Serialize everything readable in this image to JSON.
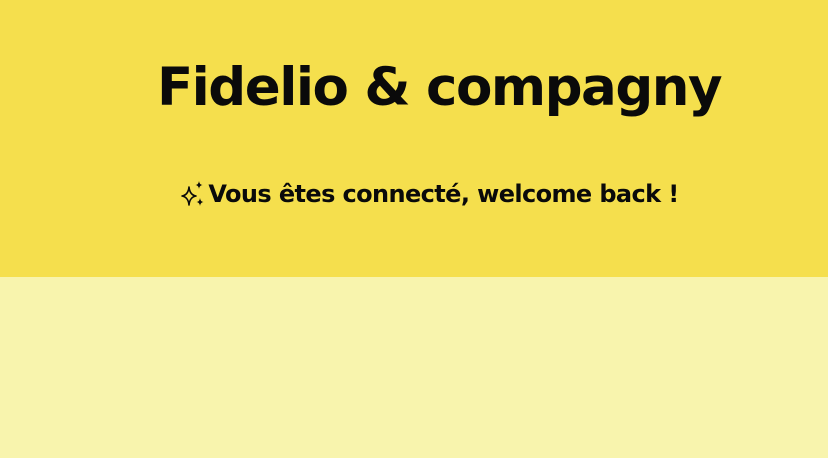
{
  "header": {
    "title": "Fidelio & compagny",
    "welcome_message": "Vous êtes connecté, welcome back !",
    "welcome_icon": "sparkles-icon"
  },
  "colors": {
    "header_background": "#f5df4d",
    "body_background": "#f8f4ad",
    "text": "#0a0a0a"
  }
}
